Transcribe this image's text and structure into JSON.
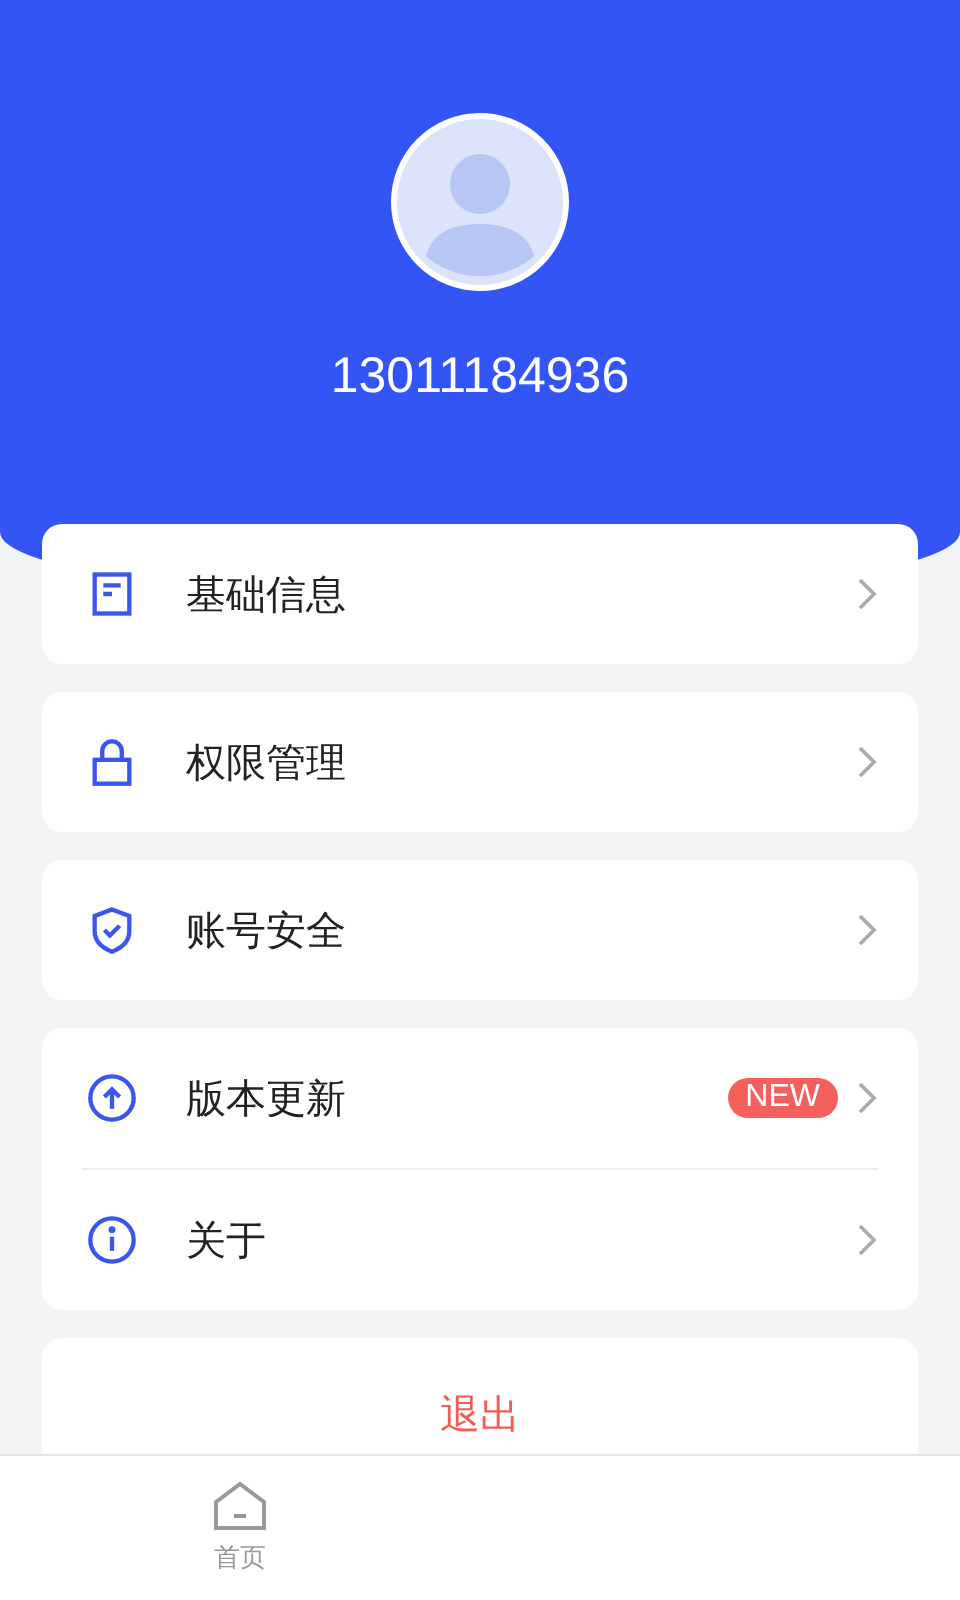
{
  "profile": {
    "phone": "13011184936"
  },
  "menu_groups": [
    {
      "items": [
        {
          "label": "基础信息"
        }
      ]
    },
    {
      "items": [
        {
          "label": "权限管理"
        }
      ]
    },
    {
      "items": [
        {
          "label": "账号安全"
        }
      ]
    },
    {
      "items": [
        {
          "label": "版本更新",
          "badge": "NEW"
        },
        {
          "label": "关于"
        }
      ]
    }
  ],
  "logout_button": "退出",
  "tab_bar": [
    {
      "label": "首页",
      "selected": false
    }
  ]
}
